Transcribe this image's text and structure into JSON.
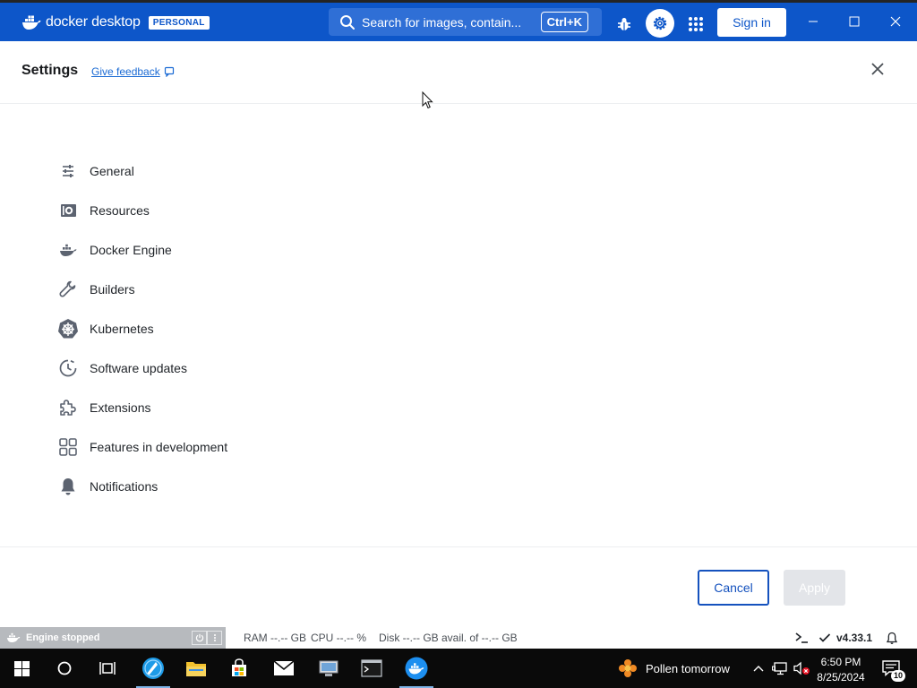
{
  "app": {
    "brand": "docker desktop",
    "plan_badge": "PERSONAL",
    "search_placeholder": "Search for images, contain...",
    "search_shortcut": "Ctrl+K",
    "sign_in": "Sign in",
    "accent_color": "#0d56c9"
  },
  "settings": {
    "title": "Settings",
    "feedback_link": "Give feedback",
    "nav": [
      {
        "label": "General",
        "icon": "sliders-icon"
      },
      {
        "label": "Resources",
        "icon": "resources-disk-icon"
      },
      {
        "label": "Docker Engine",
        "icon": "whale-icon"
      },
      {
        "label": "Builders",
        "icon": "wrench-icon"
      },
      {
        "label": "Kubernetes",
        "icon": "kubernetes-helm-icon"
      },
      {
        "label": "Software updates",
        "icon": "clock-update-icon"
      },
      {
        "label": "Extensions",
        "icon": "puzzle-icon"
      },
      {
        "label": "Features in development",
        "icon": "grid-squares-icon"
      },
      {
        "label": "Notifications",
        "icon": "bell-icon"
      }
    ],
    "cancel": "Cancel",
    "apply": "Apply"
  },
  "status": {
    "engine": "Engine stopped",
    "ram": "RAM --.-- GB",
    "cpu": "CPU --.-- %",
    "disk": "Disk --.-- GB avail. of --.-- GB",
    "version": "v4.33.1"
  },
  "taskbar": {
    "weather": "Pollen tomorrow",
    "time": "6:50 PM",
    "date": "8/25/2024",
    "notification_count": "10"
  }
}
